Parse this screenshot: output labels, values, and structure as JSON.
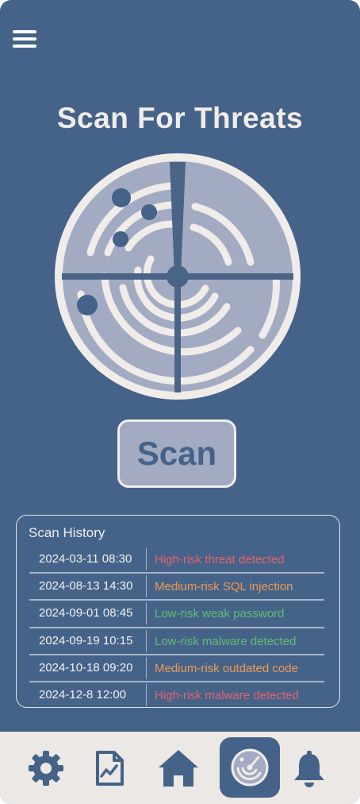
{
  "page": {
    "title": "Scan For Threats"
  },
  "scan_button": {
    "label": "Scan"
  },
  "history": {
    "title": "Scan History",
    "entries": [
      {
        "date": "2024-03-11 08:30",
        "result": "High-risk threat detected",
        "severity": "high"
      },
      {
        "date": "2024-08-13 14:30",
        "result": "Medium-risk SQL injection",
        "severity": "medium"
      },
      {
        "date": "2024-09-01 08:45",
        "result": "Low-risk weak password",
        "severity": "low"
      },
      {
        "date": "2024-09-19 10:15",
        "result": "Low-risk malware detected",
        "severity": "low"
      },
      {
        "date": "2024-10-18 09:20",
        "result": "Medium-risk outdated code",
        "severity": "medium"
      },
      {
        "date": "2024-12-8 12:00",
        "result": "High-risk malware detected",
        "severity": "high"
      }
    ]
  },
  "nav": {
    "items": [
      {
        "icon": "gear-icon",
        "active": false
      },
      {
        "icon": "report-icon",
        "active": false
      },
      {
        "icon": "home-icon",
        "active": false
      },
      {
        "icon": "radar-icon",
        "active": true
      },
      {
        "icon": "bell-icon",
        "active": false
      }
    ]
  },
  "colors": {
    "background": "#456389",
    "high": "#e3636a",
    "medium": "#ec9a52",
    "low": "#5fbe6e",
    "nav_bg": "#ece8e6"
  }
}
